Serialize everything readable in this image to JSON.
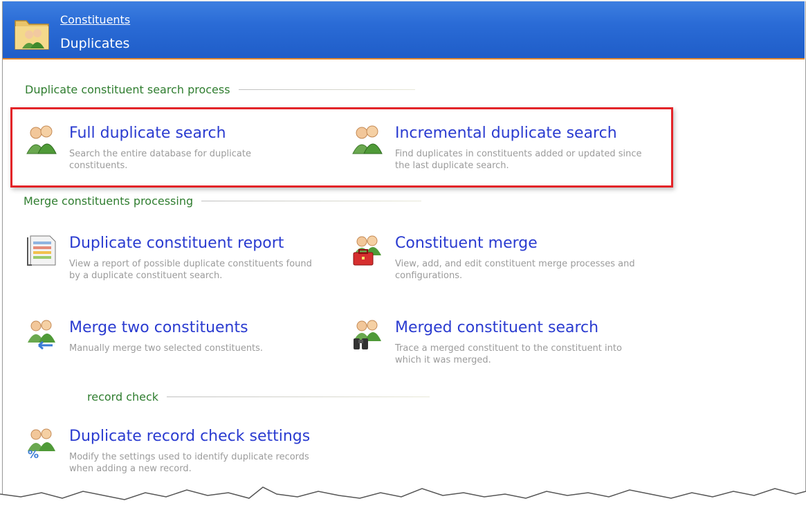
{
  "header": {
    "breadcrumb": "Constituents",
    "title": "Duplicates",
    "icon": "folder-people-icon"
  },
  "sections": {
    "search": "Duplicate constituent search process",
    "merge": "Merge constituents processing",
    "record": "record check"
  },
  "tasks": {
    "full_search": {
      "title": "Full duplicate search",
      "desc": "Search the entire database for duplicate constituents.",
      "icon": "people-icon"
    },
    "incremental_search": {
      "title": "Incremental duplicate search",
      "desc": "Find duplicates in constituents added or updated since the last duplicate search.",
      "icon": "people-icon"
    },
    "report": {
      "title": "Duplicate constituent report",
      "desc": "View a report of possible duplicate constituents found by a duplicate constituent search.",
      "icon": "report-icon"
    },
    "merge": {
      "title": "Constituent merge",
      "desc": "View, add, and edit constituent merge processes and configurations.",
      "icon": "people-toolbox-icon"
    },
    "merge_two": {
      "title": "Merge two constituents",
      "desc": "Manually merge two selected constituents.",
      "icon": "people-merge-icon"
    },
    "merged_search": {
      "title": "Merged constituent search",
      "desc": "Trace a merged constituent to the constituent into which it was merged.",
      "icon": "people-binoculars-icon"
    },
    "record_check": {
      "title": "Duplicate record check settings",
      "desc": "Modify the settings used to identify duplicate records when adding a new record.",
      "icon": "people-percent-icon"
    }
  },
  "colors": {
    "header": "#2a6bd6",
    "link": "#2a3bd0",
    "section": "#2f7d2f",
    "highlight": "#e32428"
  }
}
